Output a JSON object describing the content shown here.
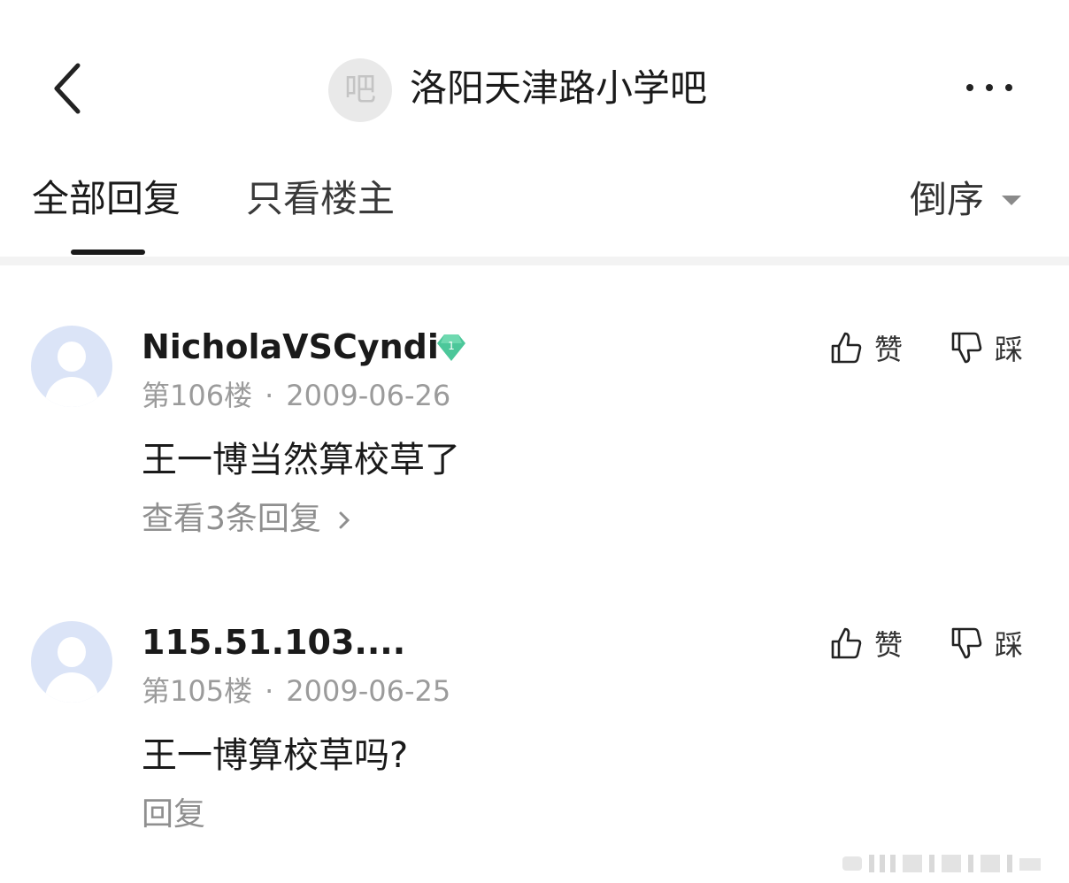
{
  "header": {
    "forum_avatar_text": "吧",
    "title": "洛阳天津路小学吧"
  },
  "tabs": {
    "all": "全部回复",
    "owner_only": "只看楼主",
    "order": "倒序"
  },
  "posts": [
    {
      "username": "NicholaVSCyndi",
      "level": "1",
      "floor": "第106楼",
      "separator": "·",
      "date": "2009-06-26",
      "content": "王一博当然算校草了",
      "reply_link": "查看3条回复",
      "like_label": "赞",
      "dislike_label": "踩"
    },
    {
      "username": "115.51.103....",
      "floor": "第105楼",
      "separator": "·",
      "date": "2009-06-25",
      "content": "王一博算校草吗?",
      "reply_link": "回复",
      "like_label": "赞",
      "dislike_label": "踩"
    }
  ],
  "colors": {
    "level_badge": "#4cc79a",
    "avatar_bg": "#dbe4f7",
    "muted_text": "#9b9b9b"
  }
}
